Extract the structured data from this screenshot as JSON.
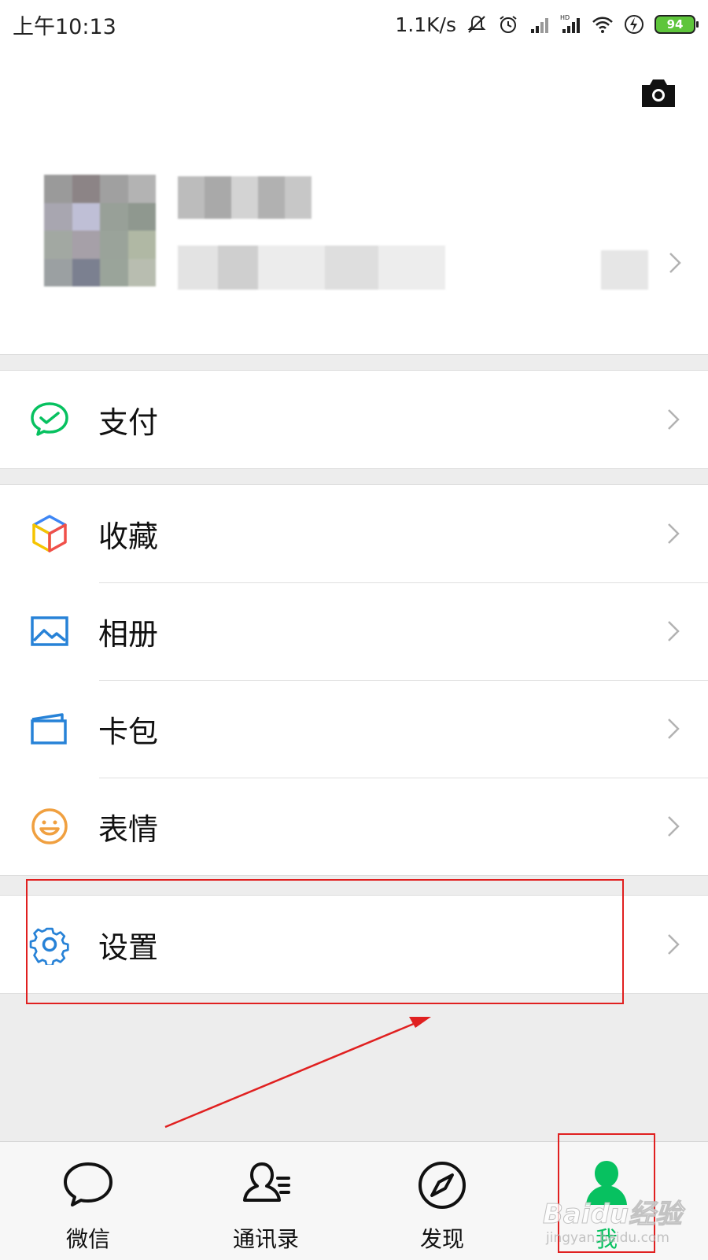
{
  "status_bar": {
    "time": "上午10:13",
    "speed": "1.1K/s",
    "battery": "94",
    "icons": [
      "mute-icon",
      "alarm-icon",
      "signal-icon",
      "hd-signal-icon",
      "wifi-icon",
      "charging-icon",
      "battery-icon"
    ]
  },
  "header": {
    "camera_icon": "camera-icon",
    "profile": {
      "avatar": "blurred-avatar",
      "name": "",
      "wechat_id": ""
    }
  },
  "menu": {
    "groups": [
      [
        {
          "label": "支付",
          "icon": "wechat-pay-icon",
          "color": "#07c160"
        }
      ],
      [
        {
          "label": "收藏",
          "icon": "favorites-cube-icon",
          "color": "#3d86f5"
        },
        {
          "label": "相册",
          "icon": "album-icon",
          "color": "#2782d7"
        },
        {
          "label": "卡包",
          "icon": "card-wallet-icon",
          "color": "#2782d7"
        },
        {
          "label": "表情",
          "icon": "sticker-smile-icon",
          "color": "#f0a040"
        }
      ],
      [
        {
          "label": "设置",
          "icon": "settings-gear-icon",
          "color": "#2782d7"
        }
      ]
    ]
  },
  "tab_bar": {
    "tabs": [
      {
        "label": "微信",
        "icon": "chat-bubble-icon",
        "active": false
      },
      {
        "label": "通讯录",
        "icon": "contacts-icon",
        "active": false
      },
      {
        "label": "发现",
        "icon": "discover-compass-icon",
        "active": false
      },
      {
        "label": "我",
        "icon": "me-person-icon",
        "active": true
      }
    ]
  },
  "colors": {
    "accent": "#07c160",
    "annotation": "#e02020",
    "background": "#ededed"
  },
  "watermark": {
    "brand": "Baidu经验",
    "url": "jingyan.baidu.com"
  }
}
